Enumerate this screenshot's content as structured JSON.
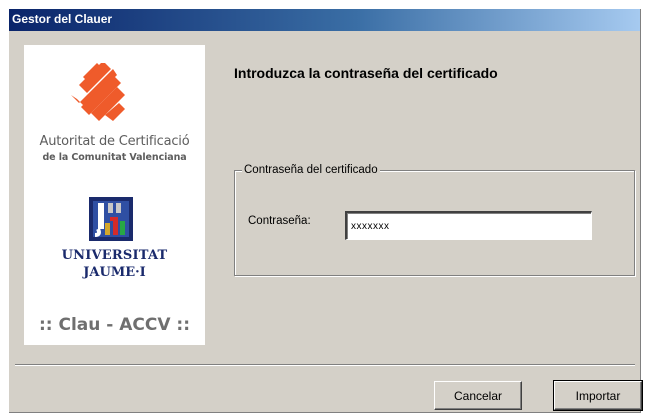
{
  "window": {
    "title": "Gestor del Clauer"
  },
  "branding": {
    "accv_line1": "Autoritat de Certificació",
    "accv_line2": "de la Comunitat Valenciana",
    "uji_line1": "UNIVERSITAT",
    "uji_line2": "JAUME·I",
    "product": ":: Clau - ACCV ::"
  },
  "main": {
    "heading": "Introduzca la contraseña del certificado"
  },
  "group": {
    "legend": "Contraseña del certificado",
    "password_label": "Contraseña:",
    "password_value": "xxxxxxx"
  },
  "buttons": {
    "cancel_label": "Cancelar",
    "import_label": "Importar"
  },
  "colors": {
    "title_gradient_start": "#0a246a",
    "dialog_background": "#d4d0c8",
    "accv_orange": "#ef5b2b",
    "uji_blue": "#1a2a6c"
  }
}
